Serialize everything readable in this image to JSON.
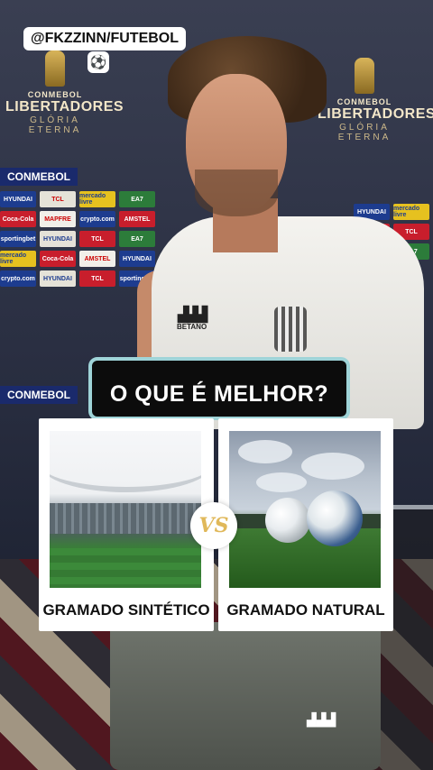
{
  "watermark": {
    "handle": "@FKZZINN/FUTEBOL",
    "icon": "soccer-ball-icon",
    "icon_glyph": "⚽"
  },
  "backdrop": {
    "brand_left": {
      "small": "CONMEBOL",
      "name": "LIBERTADORES",
      "tagline": "GLÓRIA ETERNA"
    },
    "brand_right": {
      "small": "CONMEBOL",
      "name": "LIBERTADORES",
      "tagline": "GLÓRIA ETERNA"
    },
    "bar_top": "CONMEBOL",
    "bar_bottom": "CONMEBOL",
    "sponsors": [
      "HYUNDAI",
      "TCL",
      "AMSTEL",
      "MAPFRE",
      "Coca-Cola",
      "mercado livre",
      "crypto.com",
      "sportingbet",
      "EA7"
    ]
  },
  "player": {
    "shirt_sponsor": "BETANO"
  },
  "quiz": {
    "question": "O QUE É MELHOR?",
    "options": [
      {
        "label": "GRAMADO SINTÉTICO"
      },
      {
        "label": "GRAMADO NATURAL"
      }
    ],
    "vs_text": "VS"
  },
  "colors": {
    "question_border": "#9fd4d8",
    "question_bg": "#0c0c0c",
    "vs_gold": "#e0b85a",
    "card_bg": "#ffffff"
  }
}
